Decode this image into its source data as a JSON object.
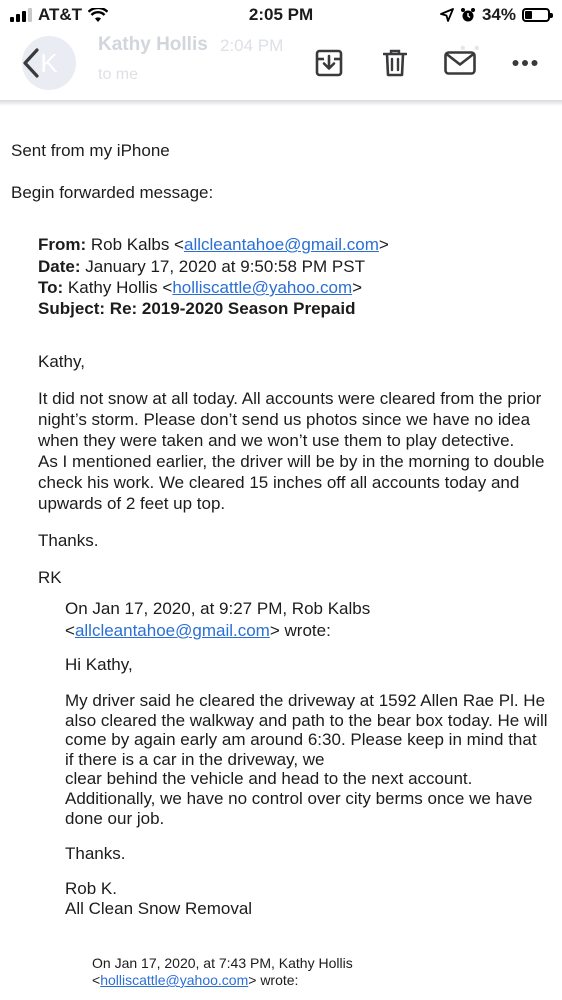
{
  "status_bar": {
    "carrier": "AT&T",
    "time": "2:05 PM",
    "battery": "34%",
    "battery_level": 0.34
  },
  "toolbar": {
    "sender_ghost": "Kathy Hollis",
    "time_ghost": "2:04 PM",
    "to_ghost": "to me"
  },
  "intro": {
    "sent_from": "Sent from my iPhone",
    "begin_forwarded": "Begin forwarded message:"
  },
  "headers": {
    "from_label": "From:",
    "from_name": " Rob Kalbs <",
    "from_email": "allcleantahoe@gmail.com",
    "from_close": ">",
    "date_label": "Date:",
    "date_value": " January 17, 2020 at 9:50:58 PM PST",
    "to_label": "To:",
    "to_name": " Kathy Hollis <",
    "to_email": "holliscattle@yahoo.com",
    "to_close": ">",
    "subject_label": "Subject:",
    "subject_value": " Re: 2019-2020 Season Prepaid"
  },
  "message": {
    "greeting": "Kathy,",
    "lines": [
      "It did not snow at all today.  All accounts were cleared from the prior",
      "night’s storm.  Please don’t send us photos since we have no idea",
      "when they were taken and we won’t use them to play detective.",
      "As I mentioned earlier, the driver will be by in the morning to double",
      "check his work. We cleared 15 inches off all accounts today and",
      "upwards of 2 feet up top."
    ],
    "thanks": "Thanks.",
    "signoff": "RK"
  },
  "quoted1": {
    "header_line1": "On Jan 17, 2020, at 9:27 PM, Rob Kalbs",
    "header_open": "<",
    "header_email": "allcleantahoe@gmail.com",
    "header_close": "> wrote:",
    "greeting": "Hi Kathy,",
    "lines": [
      "My driver said he cleared the driveway at 1592 Allen Rae Pl.  He",
      "also cleared the walkway and path to the bear box today.  He will",
      "come by again early am around 6:30.  Please keep in mind that",
      "if there is a car in the driveway, we",
      "clear behind the vehicle and head to the next account.",
      " Additionally, we have no control over city berms once we have",
      "done our job."
    ],
    "thanks": "Thanks.",
    "sig_name": "Rob K.",
    "sig_company": "All Clean Snow Removal"
  },
  "quoted2": {
    "header_line1": "On Jan 17, 2020, at 7:43 PM, Kathy Hollis",
    "header_open": "<",
    "header_email": "holliscattle@yahoo.com",
    "header_close": "> wrote:"
  },
  "colors": {
    "link": "#2a6fd6",
    "text": "#1c1c1e",
    "icon": "#3a3a3c"
  }
}
